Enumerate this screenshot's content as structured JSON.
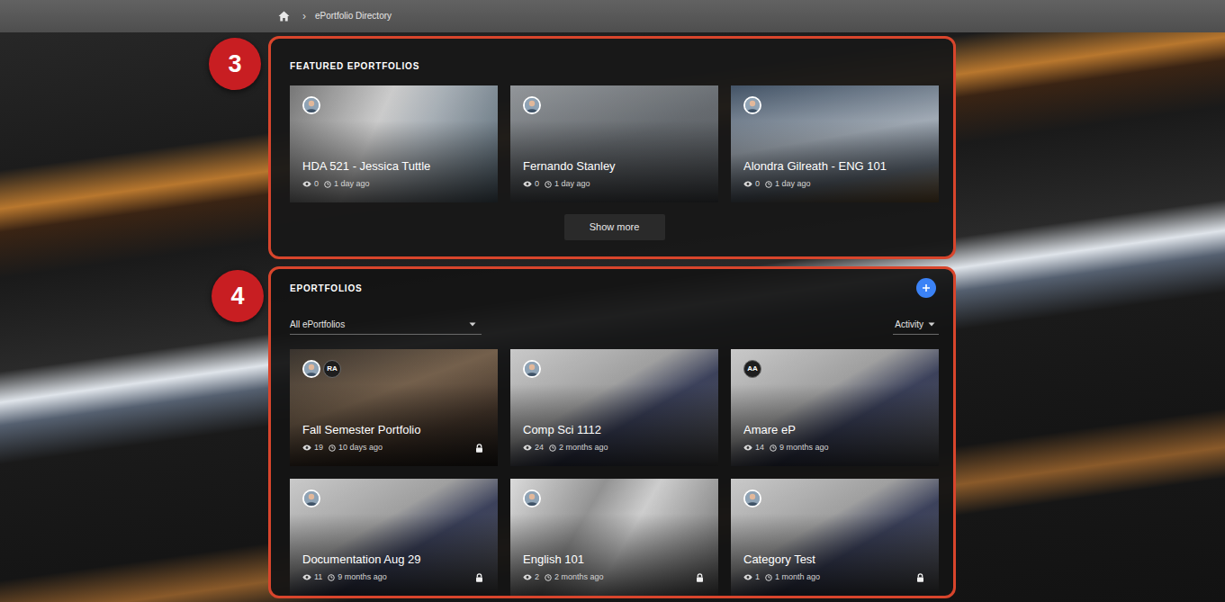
{
  "breadcrumb": {
    "separator": "›",
    "current": "ePortfolio Directory"
  },
  "featured": {
    "badge": "3",
    "title": "FEATURED EPORTFOLIOS",
    "cards": [
      {
        "title": "HDA 521 - Jessica Tuttle",
        "views": "0",
        "time": "1 day ago",
        "locked": false,
        "avatars": [
          {
            "kind": "photo"
          }
        ]
      },
      {
        "title": "Fernando Stanley",
        "views": "0",
        "time": "1 day ago",
        "locked": false,
        "avatars": [
          {
            "kind": "photo"
          }
        ]
      },
      {
        "title": "Alondra Gilreath - ENG 101",
        "views": "0",
        "time": "1 day ago",
        "locked": false,
        "avatars": [
          {
            "kind": "photo"
          }
        ]
      }
    ],
    "show_more": "Show more"
  },
  "eportfolios": {
    "badge": "4",
    "title": "EPORTFOLIOS",
    "filter": "All ePortfolios",
    "sort": "Activity",
    "cards": [
      {
        "title": "Fall Semester Portfolio",
        "views": "19",
        "time": "10 days ago",
        "locked": true,
        "avatars": [
          {
            "kind": "photo"
          },
          {
            "kind": "initials",
            "text": "RA"
          }
        ]
      },
      {
        "title": "Comp Sci 1112",
        "views": "24",
        "time": "2 months ago",
        "locked": false,
        "avatars": [
          {
            "kind": "photo"
          }
        ]
      },
      {
        "title": "Amare eP",
        "views": "14",
        "time": "9 months ago",
        "locked": false,
        "avatars": [
          {
            "kind": "initials",
            "text": "AA"
          }
        ]
      },
      {
        "title": "Documentation Aug 29",
        "views": "11",
        "time": "9 months ago",
        "locked": true,
        "avatars": [
          {
            "kind": "photo"
          }
        ]
      },
      {
        "title": "English 101",
        "views": "2",
        "time": "2 months ago",
        "locked": true,
        "avatars": [
          {
            "kind": "photo"
          }
        ]
      },
      {
        "title": "Category Test",
        "views": "1",
        "time": "1 month ago",
        "locked": true,
        "avatars": [
          {
            "kind": "photo"
          }
        ]
      }
    ]
  }
}
